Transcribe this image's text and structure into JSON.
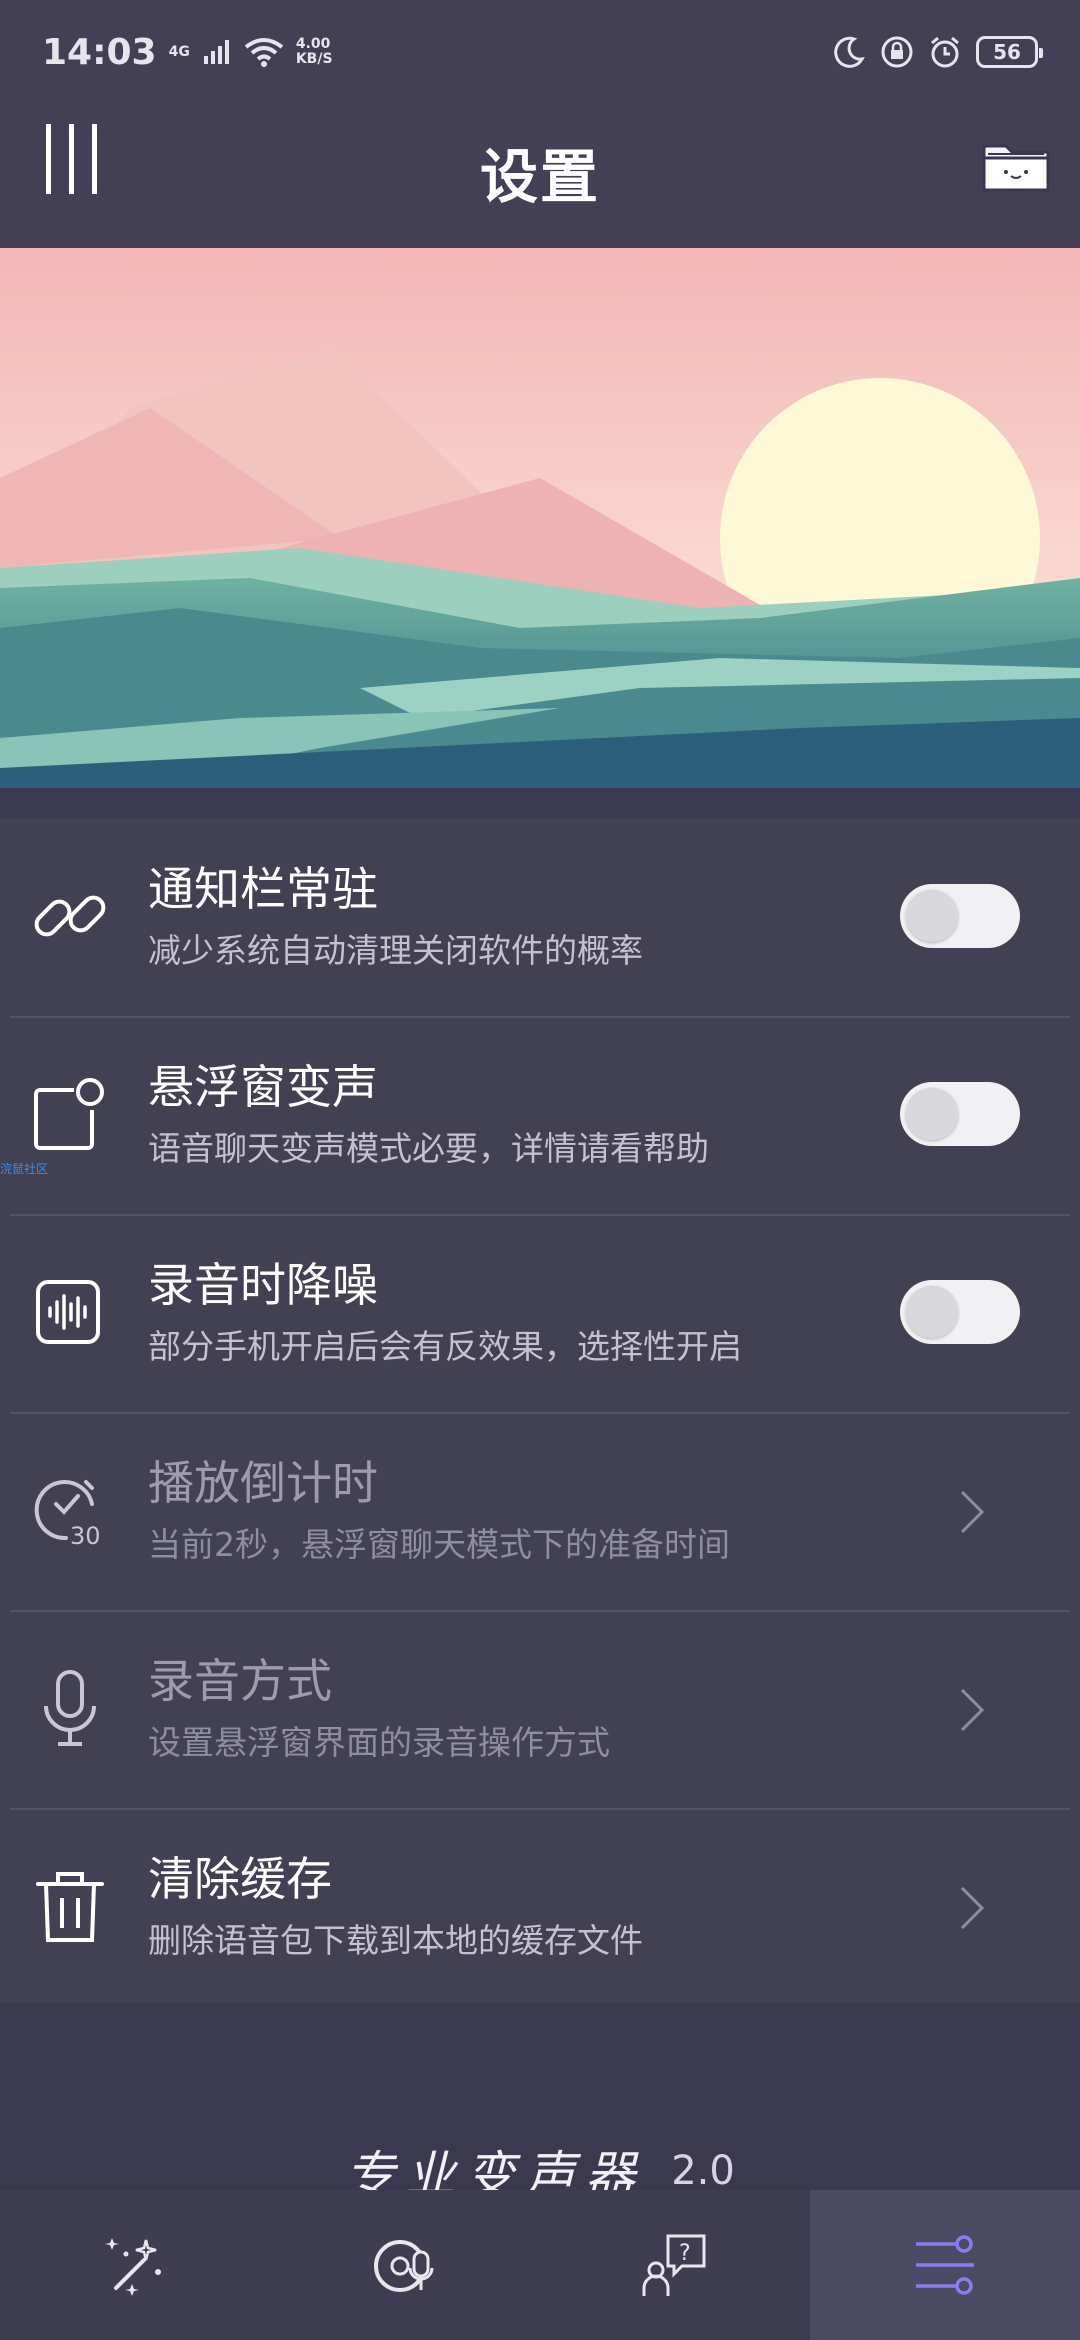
{
  "status_bar": {
    "time": "14:03",
    "network": "4G",
    "speed_value": "4.00",
    "speed_unit": "KB/S",
    "battery": "56",
    "icons": [
      "signal-icon",
      "wifi-icon",
      "moon-icon",
      "lock-icon",
      "alarm-icon",
      "battery-icon"
    ]
  },
  "app_bar": {
    "title": "设置",
    "icons": [
      "menu-icon",
      "folder-icon"
    ]
  },
  "settings": [
    {
      "title": "通知栏常驻",
      "subtitle": "减少系统自动清理关闭软件的概率",
      "icon": "link-icon",
      "control": "toggle",
      "enabled": false
    },
    {
      "title": "悬浮窗变声",
      "subtitle": "语音聊天变声模式必要，详情请看帮助",
      "icon": "floating-window-icon",
      "control": "toggle",
      "enabled": false
    },
    {
      "title": "录音时降噪",
      "subtitle": "部分手机开启后会有反效果，选择性开启",
      "icon": "waveform-icon",
      "control": "toggle",
      "enabled": false
    },
    {
      "title": "播放倒计时",
      "subtitle": "当前2秒，悬浮窗聊天模式下的准备时间",
      "icon": "timer-icon",
      "control": "chevron"
    },
    {
      "title": "录音方式",
      "subtitle": "设置悬浮窗界面的录音操作方式",
      "icon": "microphone-icon",
      "control": "chevron"
    },
    {
      "title": "清除缓存",
      "subtitle": "删除语音包下载到本地的缓存文件",
      "icon": "trash-icon",
      "control": "chevron"
    }
  ],
  "watermark": "浣鼠社区",
  "footer": {
    "brand": "专业变声器",
    "version": "2.0"
  },
  "bottom_nav": {
    "items": [
      "magic-wand-icon",
      "voice-disc-icon",
      "help-chat-icon",
      "settings-sliders-icon"
    ],
    "active_index": 3,
    "active_color": "#8b7cf0"
  },
  "colors": {
    "background": "#3b3950",
    "app_bar": "#433f55",
    "list_background": "#424053",
    "toggle_off": "#f1f1f3"
  }
}
